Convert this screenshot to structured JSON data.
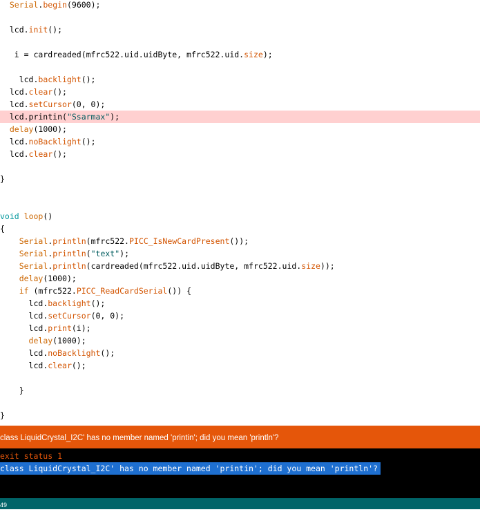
{
  "editor": {
    "lines": [
      [
        {
          "t": "  "
        },
        {
          "t": "Serial",
          "c": "obj"
        },
        {
          "t": "."
        },
        {
          "t": "begin",
          "c": "fn"
        },
        {
          "t": "(9600);"
        }
      ],
      [],
      [
        {
          "t": "  lcd."
        },
        {
          "t": "init",
          "c": "fn"
        },
        {
          "t": "();"
        }
      ],
      [],
      [
        {
          "t": "   i = cardreaded(mfrc522.uid.uidByte, mfrc522.uid."
        },
        {
          "t": "size",
          "c": "fn"
        },
        {
          "t": ");"
        }
      ],
      [],
      [
        {
          "t": "    lcd."
        },
        {
          "t": "backlight",
          "c": "fn"
        },
        {
          "t": "();"
        }
      ],
      [
        {
          "t": "  lcd."
        },
        {
          "t": "clear",
          "c": "fn"
        },
        {
          "t": "();"
        }
      ],
      [
        {
          "t": "  lcd."
        },
        {
          "t": "setCursor",
          "c": "fn"
        },
        {
          "t": "(0, 0);"
        }
      ],
      [
        {
          "t": "  lcd.printin("
        },
        {
          "t": "\"Ssarmax\"",
          "c": "str"
        },
        {
          "t": ");"
        }
      ],
      [
        {
          "t": "  "
        },
        {
          "t": "delay",
          "c": "kw"
        },
        {
          "t": "(1000);"
        }
      ],
      [
        {
          "t": "  lcd."
        },
        {
          "t": "noBacklight",
          "c": "fn"
        },
        {
          "t": "();"
        }
      ],
      [
        {
          "t": "  lcd."
        },
        {
          "t": "clear",
          "c": "fn"
        },
        {
          "t": "();"
        }
      ],
      [],
      [
        {
          "t": "}"
        }
      ],
      [],
      [],
      [
        {
          "t": "void",
          "c": "ty"
        },
        {
          "t": " "
        },
        {
          "t": "loop",
          "c": "kw"
        },
        {
          "t": "()"
        }
      ],
      [
        {
          "t": "{"
        }
      ],
      [
        {
          "t": "    "
        },
        {
          "t": "Serial",
          "c": "obj"
        },
        {
          "t": "."
        },
        {
          "t": "println",
          "c": "fn"
        },
        {
          "t": "(mfrc522."
        },
        {
          "t": "PICC_IsNewCardPresent",
          "c": "fn"
        },
        {
          "t": "());"
        }
      ],
      [
        {
          "t": "    "
        },
        {
          "t": "Serial",
          "c": "obj"
        },
        {
          "t": "."
        },
        {
          "t": "println",
          "c": "fn"
        },
        {
          "t": "("
        },
        {
          "t": "\"text\"",
          "c": "str"
        },
        {
          "t": ");"
        }
      ],
      [
        {
          "t": "    "
        },
        {
          "t": "Serial",
          "c": "obj"
        },
        {
          "t": "."
        },
        {
          "t": "println",
          "c": "fn"
        },
        {
          "t": "(cardreaded(mfrc522.uid.uidByte, mfrc522.uid."
        },
        {
          "t": "size",
          "c": "fn"
        },
        {
          "t": "));"
        }
      ],
      [
        {
          "t": "    "
        },
        {
          "t": "delay",
          "c": "kw"
        },
        {
          "t": "(1000);"
        }
      ],
      [
        {
          "t": "    "
        },
        {
          "t": "if",
          "c": "kw"
        },
        {
          "t": " (mfrc522."
        },
        {
          "t": "PICC_ReadCardSerial",
          "c": "fn"
        },
        {
          "t": "()) {"
        }
      ],
      [
        {
          "t": "      lcd."
        },
        {
          "t": "backlight",
          "c": "fn"
        },
        {
          "t": "();"
        }
      ],
      [
        {
          "t": "      lcd."
        },
        {
          "t": "setCursor",
          "c": "fn"
        },
        {
          "t": "(0, 0);"
        }
      ],
      [
        {
          "t": "      lcd."
        },
        {
          "t": "print",
          "c": "fn"
        },
        {
          "t": "(i);"
        }
      ],
      [
        {
          "t": "      "
        },
        {
          "t": "delay",
          "c": "kw"
        },
        {
          "t": "(1000);"
        }
      ],
      [
        {
          "t": "      lcd."
        },
        {
          "t": "noBacklight",
          "c": "fn"
        },
        {
          "t": "();"
        }
      ],
      [
        {
          "t": "      lcd."
        },
        {
          "t": "clear",
          "c": "fn"
        },
        {
          "t": "();"
        }
      ],
      [],
      [
        {
          "t": "    }"
        }
      ],
      [],
      [
        {
          "t": "}"
        }
      ]
    ],
    "highlighted_line": 9,
    "highlight_color": "#ffd0d0"
  },
  "error_bar": {
    "message": "class LiquidCrystal_I2C' has no member named 'printin'; did you mean 'println'?",
    "color": "#e5560a"
  },
  "console": {
    "exit_status": "exit status 1",
    "error_message": "class LiquidCrystal_I2C' has no member named 'printin'; did you mean 'println'?"
  },
  "status_bar": {
    "line_number": "49",
    "color": "#006468"
  },
  "syntax_colors": {
    "kw": "#cc6600",
    "ty": "#00979c",
    "fn": "#d35400",
    "str": "#005c5f",
    "obj": "#cc6600"
  }
}
